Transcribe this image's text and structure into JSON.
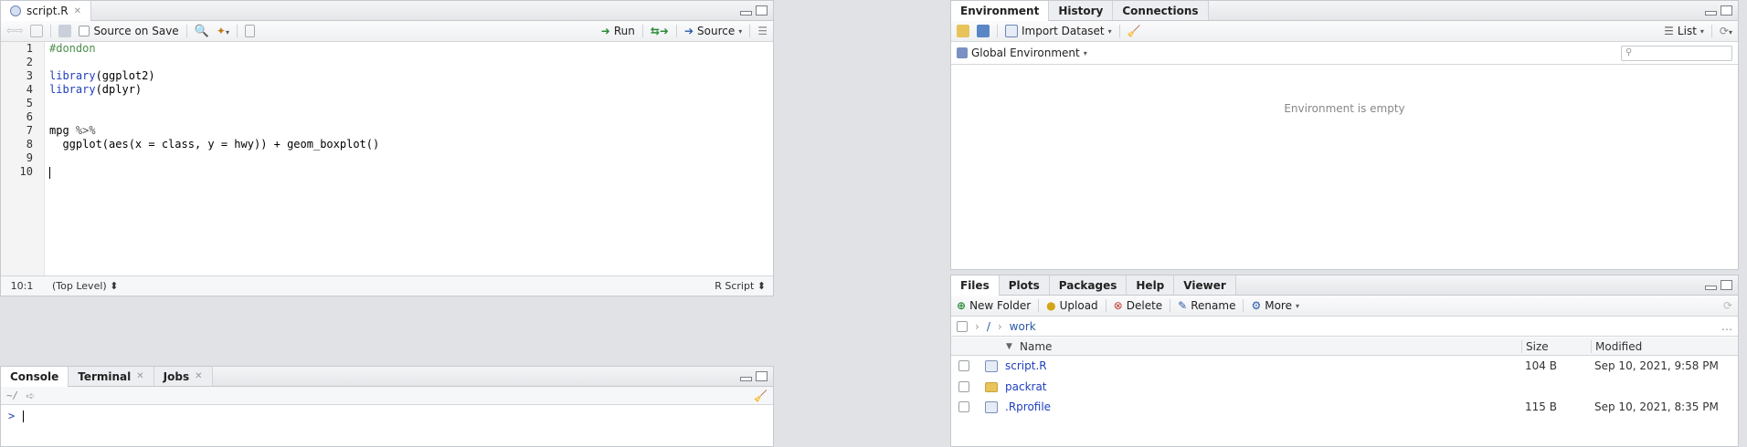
{
  "source": {
    "tab": "script.R",
    "toolbar": {
      "source_on_save": "Source on Save",
      "run": "Run",
      "source": "Source"
    },
    "lines": [
      {
        "n": "1",
        "parts": [
          {
            "t": "#dondon",
            "c": "cm"
          }
        ]
      },
      {
        "n": "2",
        "parts": []
      },
      {
        "n": "3",
        "parts": [
          {
            "t": "library",
            "c": "kw"
          },
          {
            "t": "(ggplot2)",
            "c": ""
          }
        ]
      },
      {
        "n": "4",
        "parts": [
          {
            "t": "library",
            "c": "kw"
          },
          {
            "t": "(dplyr)",
            "c": ""
          }
        ]
      },
      {
        "n": "5",
        "parts": []
      },
      {
        "n": "6",
        "parts": []
      },
      {
        "n": "7",
        "parts": [
          {
            "t": "mpg ",
            "c": ""
          },
          {
            "t": "%>%",
            "c": "op"
          }
        ]
      },
      {
        "n": "8",
        "parts": [
          {
            "t": "  ggplot(aes(x = class, y = hwy)) + geom_boxplot()",
            "c": ""
          }
        ]
      },
      {
        "n": "9",
        "parts": []
      },
      {
        "n": "10",
        "parts": []
      }
    ],
    "status": {
      "position": "10:1",
      "scope": "(Top Level) ⬍",
      "filetype": "R Script ⬍"
    }
  },
  "console": {
    "tabs": {
      "console": "Console",
      "terminal": "Terminal",
      "jobs": "Jobs"
    },
    "path": "~/",
    "prompt": ">"
  },
  "environment": {
    "tabs": {
      "environment": "Environment",
      "history": "History",
      "connections": "Connections"
    },
    "toolbar": {
      "import": "Import Dataset",
      "list": "List"
    },
    "scope": "Global Environment",
    "empty": "Environment is empty"
  },
  "files": {
    "tabs": {
      "files": "Files",
      "plots": "Plots",
      "packages": "Packages",
      "help": "Help",
      "viewer": "Viewer"
    },
    "toolbar": {
      "new_folder": "New Folder",
      "upload": "Upload",
      "delete": "Delete",
      "rename": "Rename",
      "more": "More"
    },
    "breadcrumb": {
      "root": "/",
      "sep": "›",
      "work": "work"
    },
    "headers": {
      "name": "Name",
      "size": "Size",
      "modified": "Modified"
    },
    "rows": [
      {
        "name": "script.R",
        "size": "104 B",
        "modified": "Sep 10, 2021, 9:58 PM"
      },
      {
        "name": "packrat",
        "size": "",
        "modified": ""
      },
      {
        "name": ".Rprofile",
        "size": "115 B",
        "modified": "Sep 10, 2021, 8:35 PM"
      }
    ]
  }
}
